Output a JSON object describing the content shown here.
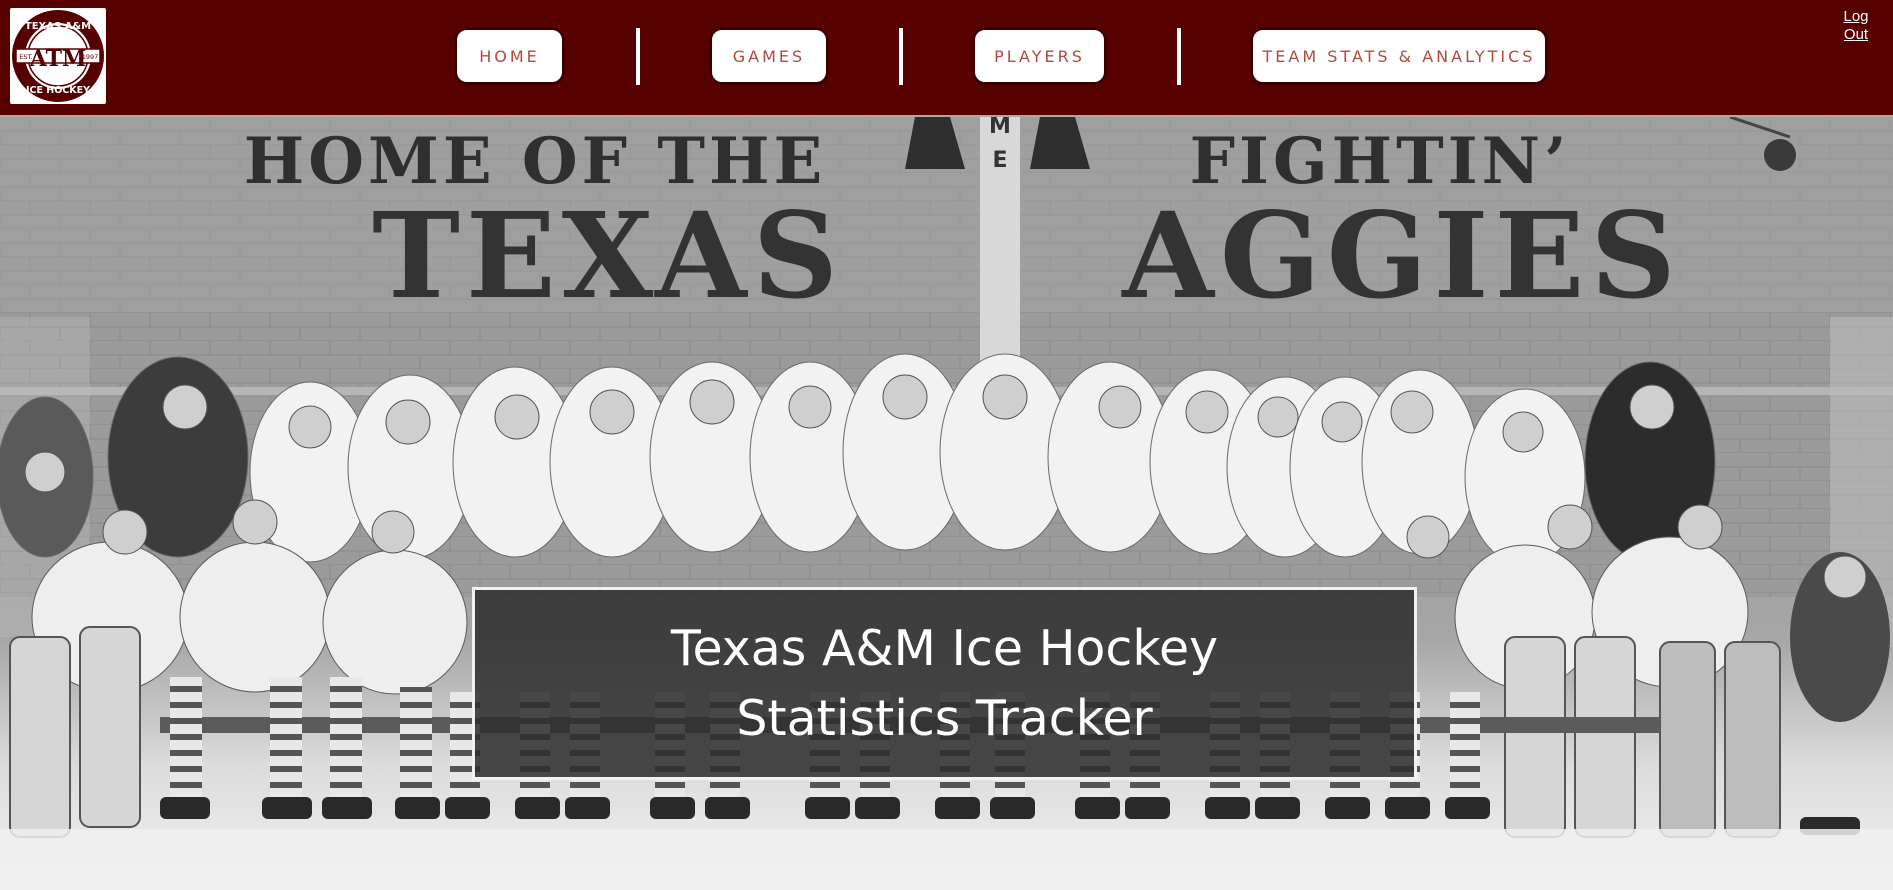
{
  "header": {
    "logo": {
      "top_text": "TEXAS A&M",
      "left_text": "EST.",
      "right_text": "1997",
      "mark": "ATM",
      "bottom_text": "ICE HOCKEY",
      "colors": {
        "maroon": "#570000",
        "white": "#ffffff"
      }
    },
    "nav": [
      {
        "label": "HOME"
      },
      {
        "label": "GAMES"
      },
      {
        "label": "PLAYERS"
      },
      {
        "label": "TEAM STATS & ANALYTICS"
      }
    ],
    "logout_line1": "Log",
    "logout_line2": "Out"
  },
  "hero": {
    "wall_text_line1_left": "HOME OF THE",
    "wall_text_line1_right": "FIGHTIN’",
    "wall_text_line2_left": "TEXAS",
    "wall_text_line2_right": "AGGIES",
    "title_line1": "Texas A&M Ice Hockey",
    "title_line2": "Statistics Tracker"
  },
  "colors": {
    "header_bg": "#570000",
    "nav_text": "#b24a3a",
    "title_overlay": "#2d2d2d"
  }
}
